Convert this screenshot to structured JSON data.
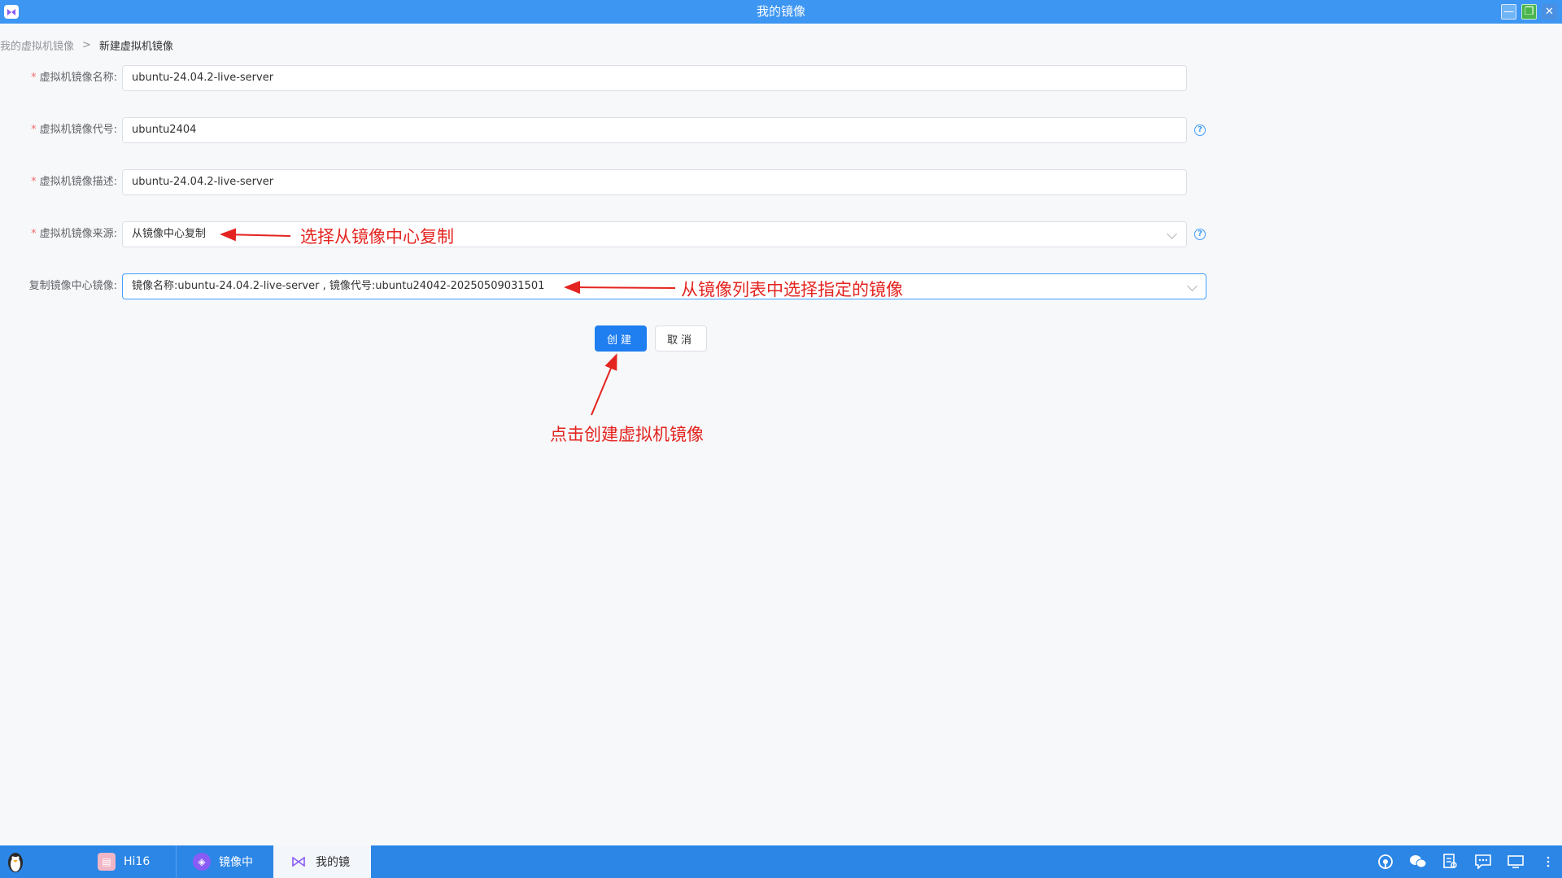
{
  "window": {
    "title": "我的镜像",
    "minimize_glyph": "—",
    "maximize_glyph": "❐",
    "close_glyph": "✕"
  },
  "breadcrumb": {
    "parent": "我的虚拟机镜像",
    "separator": ">",
    "current": "新建虚拟机镜像"
  },
  "form": {
    "name": {
      "required": "*",
      "label": "虚拟机镜像名称:",
      "value": "ubuntu-24.04.2-live-server"
    },
    "code": {
      "required": "*",
      "label": "虚拟机镜像代号:",
      "value": "ubuntu2404"
    },
    "description": {
      "required": "*",
      "label": "虚拟机镜像描述:",
      "value": "ubuntu-24.04.2-live-server"
    },
    "source": {
      "required": "*",
      "label": "虚拟机镜像来源:",
      "value": "从镜像中心复制"
    },
    "center_image": {
      "label": "复制镜像中心镜像:",
      "value": "镜像名称:ubuntu-24.04.2-live-server , 镜像代号:ubuntu24042-20250509031501"
    },
    "help_glyph": "?"
  },
  "buttons": {
    "create": "创建",
    "cancel": "取消"
  },
  "annotations": {
    "source_hint": "选择从镜像中心复制",
    "image_hint": "从镜像列表中选择指定的镜像",
    "create_hint": "点击创建虚拟机镜像"
  },
  "taskbar": {
    "items": [
      {
        "label": "Hi16"
      },
      {
        "label": "镜像中"
      },
      {
        "label": "我的镜"
      }
    ]
  },
  "colors": {
    "titlebar": "#3d96f2",
    "primary": "#1f7ef0",
    "annotation": "#e32420",
    "taskbar": "#2b86e6"
  }
}
